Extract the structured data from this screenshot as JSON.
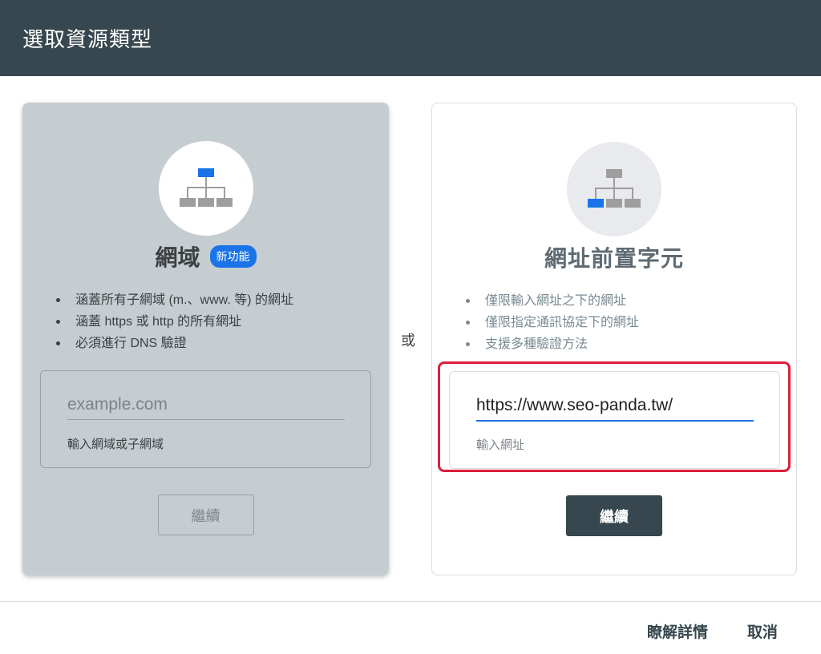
{
  "dialog": {
    "title": "選取資源類型"
  },
  "domain_card": {
    "title": "網域",
    "badge": "新功能",
    "icon": "sitemap-icon",
    "bullets": [
      "涵蓋所有子網域 (m.、www. 等) 的網址",
      "涵蓋 https 或 http 的所有網址",
      "必須進行 DNS 驗證"
    ],
    "input_placeholder": "example.com",
    "input_helper": "輸入網域或子網域",
    "continue_label": "繼續"
  },
  "or_label": "或",
  "prefix_card": {
    "title": "網址前置字元",
    "icon": "sitemap-icon",
    "bullets": [
      "僅限輸入網址之下的網址",
      "僅限指定通訊協定下的網址",
      "支援多種驗證方法"
    ],
    "input_value": "https://www.seo-panda.tw/",
    "input_helper": "輸入網址",
    "continue_label": "繼續"
  },
  "footer": {
    "learn_more_label": "瞭解詳情",
    "cancel_label": "取消"
  },
  "colors": {
    "header_bg": "#37474f",
    "accent_blue": "#1a73e8",
    "highlight_red": "#dc1e3c",
    "domain_card_bg": "#c5cdd1"
  }
}
